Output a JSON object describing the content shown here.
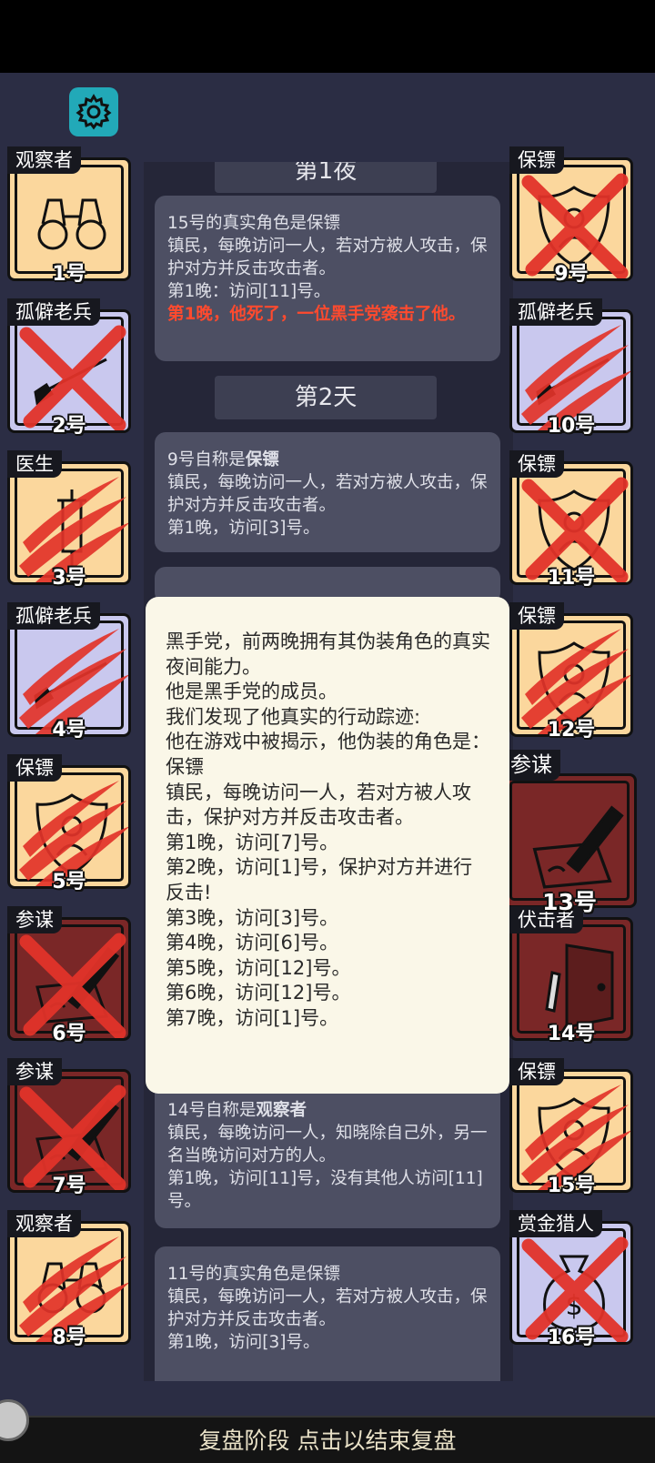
{
  "cards": [
    {
      "id": "1",
      "role": "观察者",
      "num": "1号",
      "icon": "binoculars-icon",
      "bg": "town",
      "mark": "none"
    },
    {
      "id": "2",
      "role": "孤僻老兵",
      "num": "2号",
      "icon": "rifle-icon",
      "bg": "lav",
      "mark": "x"
    },
    {
      "id": "3",
      "role": "医生",
      "num": "3号",
      "icon": "syringe-icon",
      "bg": "town",
      "mark": "claw"
    },
    {
      "id": "4",
      "role": "孤僻老兵",
      "num": "4号",
      "icon": "rifle-icon",
      "bg": "lav",
      "mark": "claw"
    },
    {
      "id": "5",
      "role": "保镖",
      "num": "5号",
      "icon": "shield-icon",
      "bg": "town",
      "mark": "claw"
    },
    {
      "id": "6",
      "role": "参谋",
      "num": "6号",
      "icon": "pen-icon",
      "bg": "maf",
      "mark": "x"
    },
    {
      "id": "7",
      "role": "参谋",
      "num": "7号",
      "icon": "pen-icon",
      "bg": "maf",
      "mark": "x"
    },
    {
      "id": "8",
      "role": "观察者",
      "num": "8号",
      "icon": "binoculars-icon",
      "bg": "town",
      "mark": "claw"
    },
    {
      "id": "9",
      "role": "保镖",
      "num": "9号",
      "icon": "shield-icon",
      "bg": "town",
      "mark": "x"
    },
    {
      "id": "10",
      "role": "孤僻老兵",
      "num": "10号",
      "icon": "rifle-icon",
      "bg": "lav",
      "mark": "claw"
    },
    {
      "id": "11",
      "role": "保镖",
      "num": "11号",
      "icon": "shield-icon",
      "bg": "town",
      "mark": "x"
    },
    {
      "id": "12",
      "role": "保镖",
      "num": "12号",
      "icon": "shield-icon",
      "bg": "town",
      "mark": "claw"
    },
    {
      "id": "13",
      "role": "参谋",
      "num": "13号",
      "icon": "pen-icon",
      "bg": "maf",
      "mark": "none"
    },
    {
      "id": "14",
      "role": "伏击者",
      "num": "14号",
      "icon": "door-knife-icon",
      "bg": "maf",
      "mark": "none"
    },
    {
      "id": "15",
      "role": "保镖",
      "num": "15号",
      "icon": "shield-icon",
      "bg": "town",
      "mark": "claw"
    },
    {
      "id": "16",
      "role": "赏金猎人",
      "num": "16号",
      "icon": "moneybag-icon",
      "bg": "lav",
      "mark": "x"
    }
  ],
  "log": {
    "night1_label": "第1夜",
    "day2_label": "第2天",
    "entry1": {
      "head": "15号的真实角色是保镖",
      "desc": "镇民，每晚访问一人，若对方被人攻击，保护对方并反击攻击者。",
      "visit": "第1晚：访问[11]号。",
      "death": "第1晚，他死了，一位黑手党袭击了他。"
    },
    "entry2": {
      "prefix": "9号自称是",
      "role": "保镖",
      "desc": "镇民，每晚访问一人，若对方被人攻击，保护对方并反击攻击者。",
      "visit": "第1晚，访问[3]号。"
    },
    "entry3": {
      "prefix": "14号自称是",
      "role": "观察者",
      "desc": "镇民，每晚访问一人，知晓除自己外，另一名当晚访问对方的人。",
      "visit": "第1晚，访问[11]号，没有其他人访问[11]号。"
    },
    "entry4": {
      "head": "11号的真实角色是保镖",
      "desc": "镇民，每晚访问一人，若对方被人攻击，保护对方并反击攻击者。",
      "visit": "第1晚，访问[3]号。"
    }
  },
  "popup": {
    "lines": [
      "黑手党，前两晚拥有其伪装角色的真实夜间能力。",
      "他是黑手党的成员。",
      "我们发现了他真实的行动踪迹:",
      "他在游戏中被揭示，他伪装的角色是：保镖",
      "镇民，每晚访问一人，若对方被人攻击，保护对方并反击攻击者。",
      "第1晚，访问[7]号。",
      "第2晚，访问[1]号，保护对方并进行反击!",
      "第3晚，访问[3]号。",
      "第4晚，访问[6]号。",
      "第5晚，访问[12]号。",
      "第6晚，访问[12]号。",
      "第7晚，访问[1]号。"
    ]
  },
  "footer": {
    "label": "复盘阶段 点击以结束复盘"
  },
  "colors": {
    "town": "#fbd79d",
    "lavender": "#c9c8ee",
    "mafia": "#7a2727",
    "slash": "#e2332a",
    "teal": "#22a9b8"
  }
}
